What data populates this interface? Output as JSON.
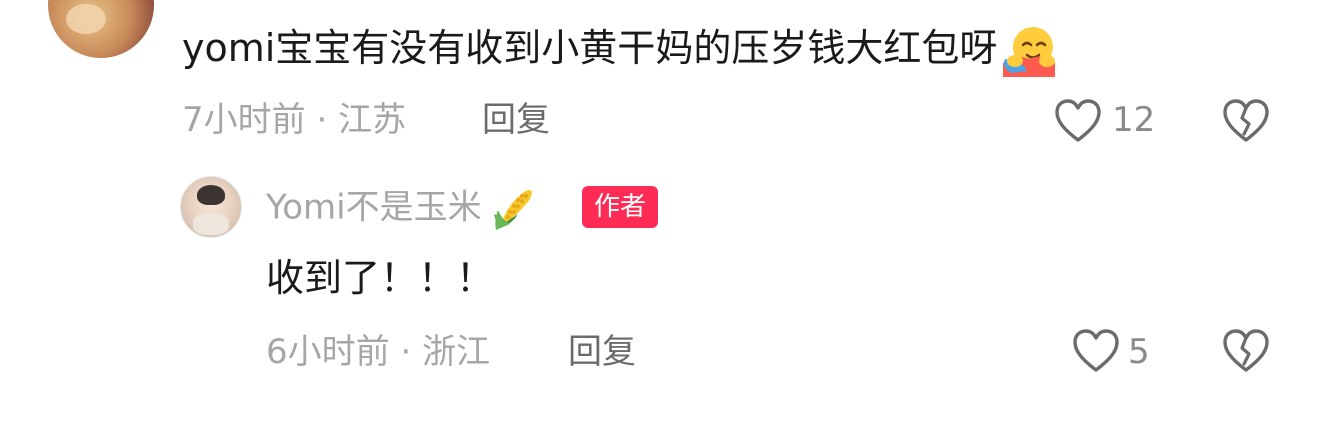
{
  "comment": {
    "text": "yomi宝宝有没有收到小黄干妈的压岁钱大红包呀",
    "emoji_icon": "hugging-face-emoji",
    "time": "7小时前",
    "location": "江苏",
    "meta_separator": " · ",
    "reply_label": "回复",
    "like_count": "12",
    "like_icon": "heart-outline-icon",
    "dislike_icon": "broken-heart-icon"
  },
  "reply": {
    "username": "Yomi不是玉米",
    "name_emoji": "corn-emoji",
    "author_badge": "作者",
    "text": "收到了！！！",
    "time": "6小时前",
    "location": "浙江",
    "meta_separator": " · ",
    "reply_label": "回复",
    "like_count": "5",
    "like_icon": "heart-outline-icon",
    "dislike_icon": "broken-heart-icon"
  },
  "colors": {
    "badge": "#fe2c55",
    "meta_text": "#a6a6a6",
    "body_text": "#1a1a1a",
    "icon": "#6b6b6b"
  }
}
